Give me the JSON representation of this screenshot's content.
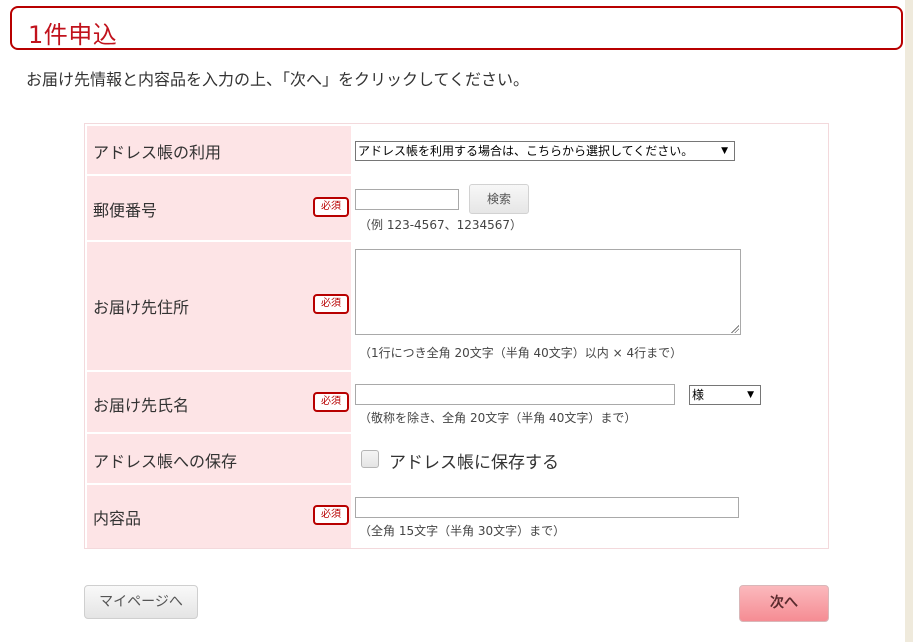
{
  "page": {
    "title": "1件申込",
    "instruction": "お届け先情報と内容品を入力の上、「次へ」をクリックしてください。"
  },
  "form": {
    "required_badge": "必須",
    "address_book": {
      "label": "アドレス帳の利用",
      "select_value": "アドレス帳を利用する場合は、こちらから選択してください。"
    },
    "postal_code": {
      "label": "郵便番号",
      "value": "",
      "search_button": "検索",
      "hint": "（例 123-4567、1234567）"
    },
    "address": {
      "label": "お届け先住所",
      "value": "",
      "hint": "（1行につき全角 20文字（半角 40文字）以内 × 4行まで）"
    },
    "name": {
      "label": "お届け先氏名",
      "value": "",
      "honorific": "様",
      "hint": "（敬称を除き、全角 20文字（半角 40文字）まで）"
    },
    "save_to_book": {
      "label": "アドレス帳への保存",
      "checkbox_label": "アドレス帳に保存する",
      "checked": false
    },
    "contents": {
      "label": "内容品",
      "value": "",
      "hint": "（全角 15文字（半角 30文字）まで）"
    }
  },
  "buttons": {
    "mypage": "マイページへ",
    "next": "次へ"
  },
  "colors": {
    "brand_red": "#b80000",
    "label_bg": "#fde4e6",
    "next_button": "#f58c93"
  }
}
